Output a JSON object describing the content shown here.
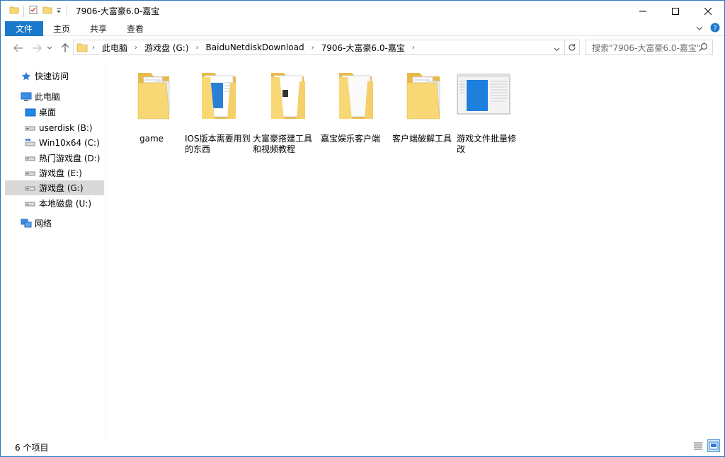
{
  "window": {
    "title": "7906-大富豪6.0-嘉宝"
  },
  "ribbon": {
    "tabs": [
      "文件",
      "主页",
      "共享",
      "查看"
    ]
  },
  "address": {
    "crumbs": [
      "此电脑",
      "游戏盘 (G:)",
      "BaiduNetdiskDownload",
      "7906-大富豪6.0-嘉宝"
    ]
  },
  "search": {
    "placeholder": "搜索\"7906-大富豪6.0-嘉宝\""
  },
  "nav": {
    "quick_access": "快速访问",
    "this_pc": "此电脑",
    "desktop": "桌面",
    "drives": [
      "userdisk (B:)",
      "Win10x64 (C:)",
      "热门游戏盘 (D:)",
      "游戏盘 (E:)",
      "游戏盘 (G:)",
      "本地磁盘 (U:)"
    ],
    "network": "网络"
  },
  "files": [
    {
      "name": "game"
    },
    {
      "name": "IOS版本需要用到的东西"
    },
    {
      "name": "大富豪搭建工具和视频教程"
    },
    {
      "name": "嘉宝娱乐客户端"
    },
    {
      "name": "客户端破解工具"
    },
    {
      "name": "游戏文件批量修改"
    }
  ],
  "status": {
    "count": "6 个项目"
  },
  "colors": {
    "accent": "#1979ca",
    "folder": "#f8d775",
    "selected": "#d9d9d9"
  }
}
